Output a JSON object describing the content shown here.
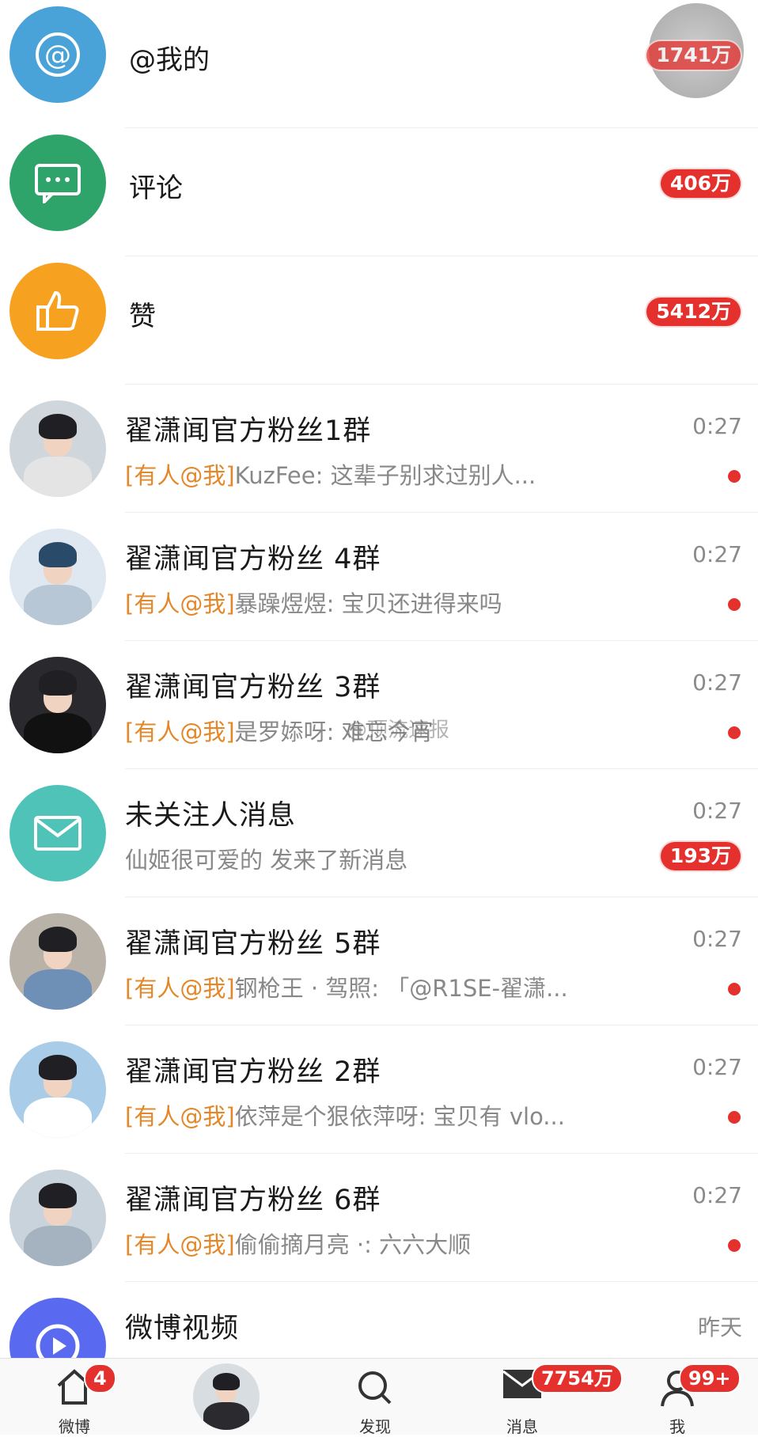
{
  "system_rows": [
    {
      "title": "@我的",
      "count": "1741万",
      "icon": "at-icon",
      "color": "#4aa3d8"
    },
    {
      "title": "评论",
      "count": "406万",
      "icon": "comment-icon",
      "color": "#2ea46a"
    },
    {
      "title": "赞",
      "count": "5412万",
      "icon": "thumbs-up-icon",
      "color": "#f7a120"
    }
  ],
  "chats": [
    {
      "title": "翟潇闻官方粉丝1群",
      "mention": "[有人@我]",
      "preview": "KuzFee: 这辈子别求过别人...",
      "time": "0:27",
      "bg": "#cfd6dc",
      "body": "#e4e4e4"
    },
    {
      "title": "翟潇闻官方粉丝 4群",
      "mention": "[有人@我]",
      "preview": "暴躁煜煜: 宝贝还进得来吗",
      "time": "0:27",
      "bg": "#dfe8f0",
      "body": "#b8c7d6"
    },
    {
      "title": "翟潇闻官方粉丝 3群",
      "mention": "[有人@我]",
      "preview": "是罗婖呀: 难忘今宵",
      "time": "0:27",
      "bg": "#2a2a2e",
      "body": "#1b1b1e"
    },
    {
      "title": "未关注人消息",
      "mention": "",
      "preview": "仙姬很可爱的 发来了新消息",
      "time": "0:27",
      "badge": "193万",
      "is_system": true
    },
    {
      "title": "翟潇闻官方粉丝 5群",
      "mention": "[有人@我]",
      "preview": "钢枪王 · 驾照: 「@R1SE-翟潇...",
      "time": "0:27",
      "bg": "#b9b2a8",
      "body": "#6e8fb6"
    },
    {
      "title": "翟潇闻官方粉丝 2群",
      "mention": "[有人@我]",
      "preview": "依萍是个狠依萍呀: 宝贝有 vlo...",
      "time": "0:27",
      "bg": "#a9cde8",
      "body": "#ffffff"
    },
    {
      "title": "翟潇闻官方粉丝 6群",
      "mention": "[有人@我]",
      "preview": "偷偷摘月亮 ·: 六六大顺",
      "time": "0:27",
      "bg": "#c9d3dc",
      "body": "#a5b2c0"
    },
    {
      "title": "微博视频",
      "mention": "",
      "preview": "",
      "time": "昨天",
      "is_video": true
    }
  ],
  "watermark": "@顶流速报",
  "tabbar": {
    "home": {
      "label": "微博",
      "badge": "4"
    },
    "discover": {
      "label": "发现"
    },
    "messages": {
      "label": "消息",
      "badge": "7754万"
    },
    "me": {
      "label": "我",
      "badge": "99+"
    }
  }
}
